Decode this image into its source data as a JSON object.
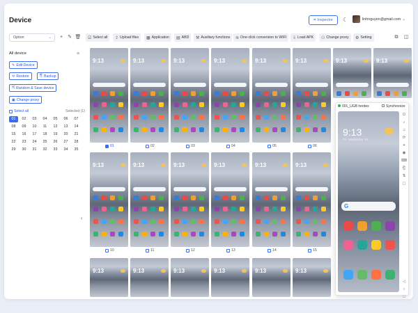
{
  "header": {
    "title": "Device",
    "inspector_label": "Inspector",
    "email": "linhnguyen@gmail.com"
  },
  "toolbar": {
    "option_select": "Option",
    "buttons": [
      {
        "label": "Select all",
        "icon": "select-all-icon"
      },
      {
        "label": "Upload files",
        "icon": "upload-icon"
      },
      {
        "label": "Application",
        "icon": "grid-icon"
      },
      {
        "label": "ABD",
        "icon": "file-icon"
      },
      {
        "label": "Auxiliary functions",
        "icon": "tools-icon"
      },
      {
        "label": "One-click conversion to WIFI",
        "icon": "wifi-icon"
      },
      {
        "label": "Load APK",
        "icon": "download-icon"
      },
      {
        "label": "Change proxy",
        "icon": "proxy-icon"
      },
      {
        "label": "Setting",
        "icon": "gear-icon"
      }
    ]
  },
  "sidebar": {
    "all_device": "All device",
    "edit_device": "Edit Device",
    "restore": "Restore",
    "backup": "Backup",
    "random_save": "Random & Save device",
    "change_proxy": "Change proxy",
    "select_all": "Select all",
    "selected": "Selected (1)",
    "numbers": [
      "01",
      "02",
      "03",
      "04",
      "05",
      "06",
      "07",
      "08",
      "09",
      "10",
      "11",
      "12",
      "13",
      "14",
      "15",
      "16",
      "17",
      "18",
      "19",
      "20",
      "21",
      "22",
      "23",
      "24",
      "25",
      "26",
      "27",
      "28",
      "29",
      "30",
      "31",
      "32",
      "33",
      "34",
      "35"
    ],
    "active_number": "01"
  },
  "grid": {
    "row1_labels": [
      "01",
      "02",
      "03",
      "04",
      "05",
      "06"
    ],
    "row2_labels": [
      "10",
      "11",
      "12",
      "13",
      "14",
      "15"
    ],
    "selected": "01",
    "phone_time": "9:13"
  },
  "popup": {
    "device": "001_UGB herdes",
    "sync": "Synchronize",
    "time": "9:13",
    "date": "Fri, September 19",
    "google_letter": "G"
  },
  "colors": {
    "accent": "#3c6df0"
  }
}
